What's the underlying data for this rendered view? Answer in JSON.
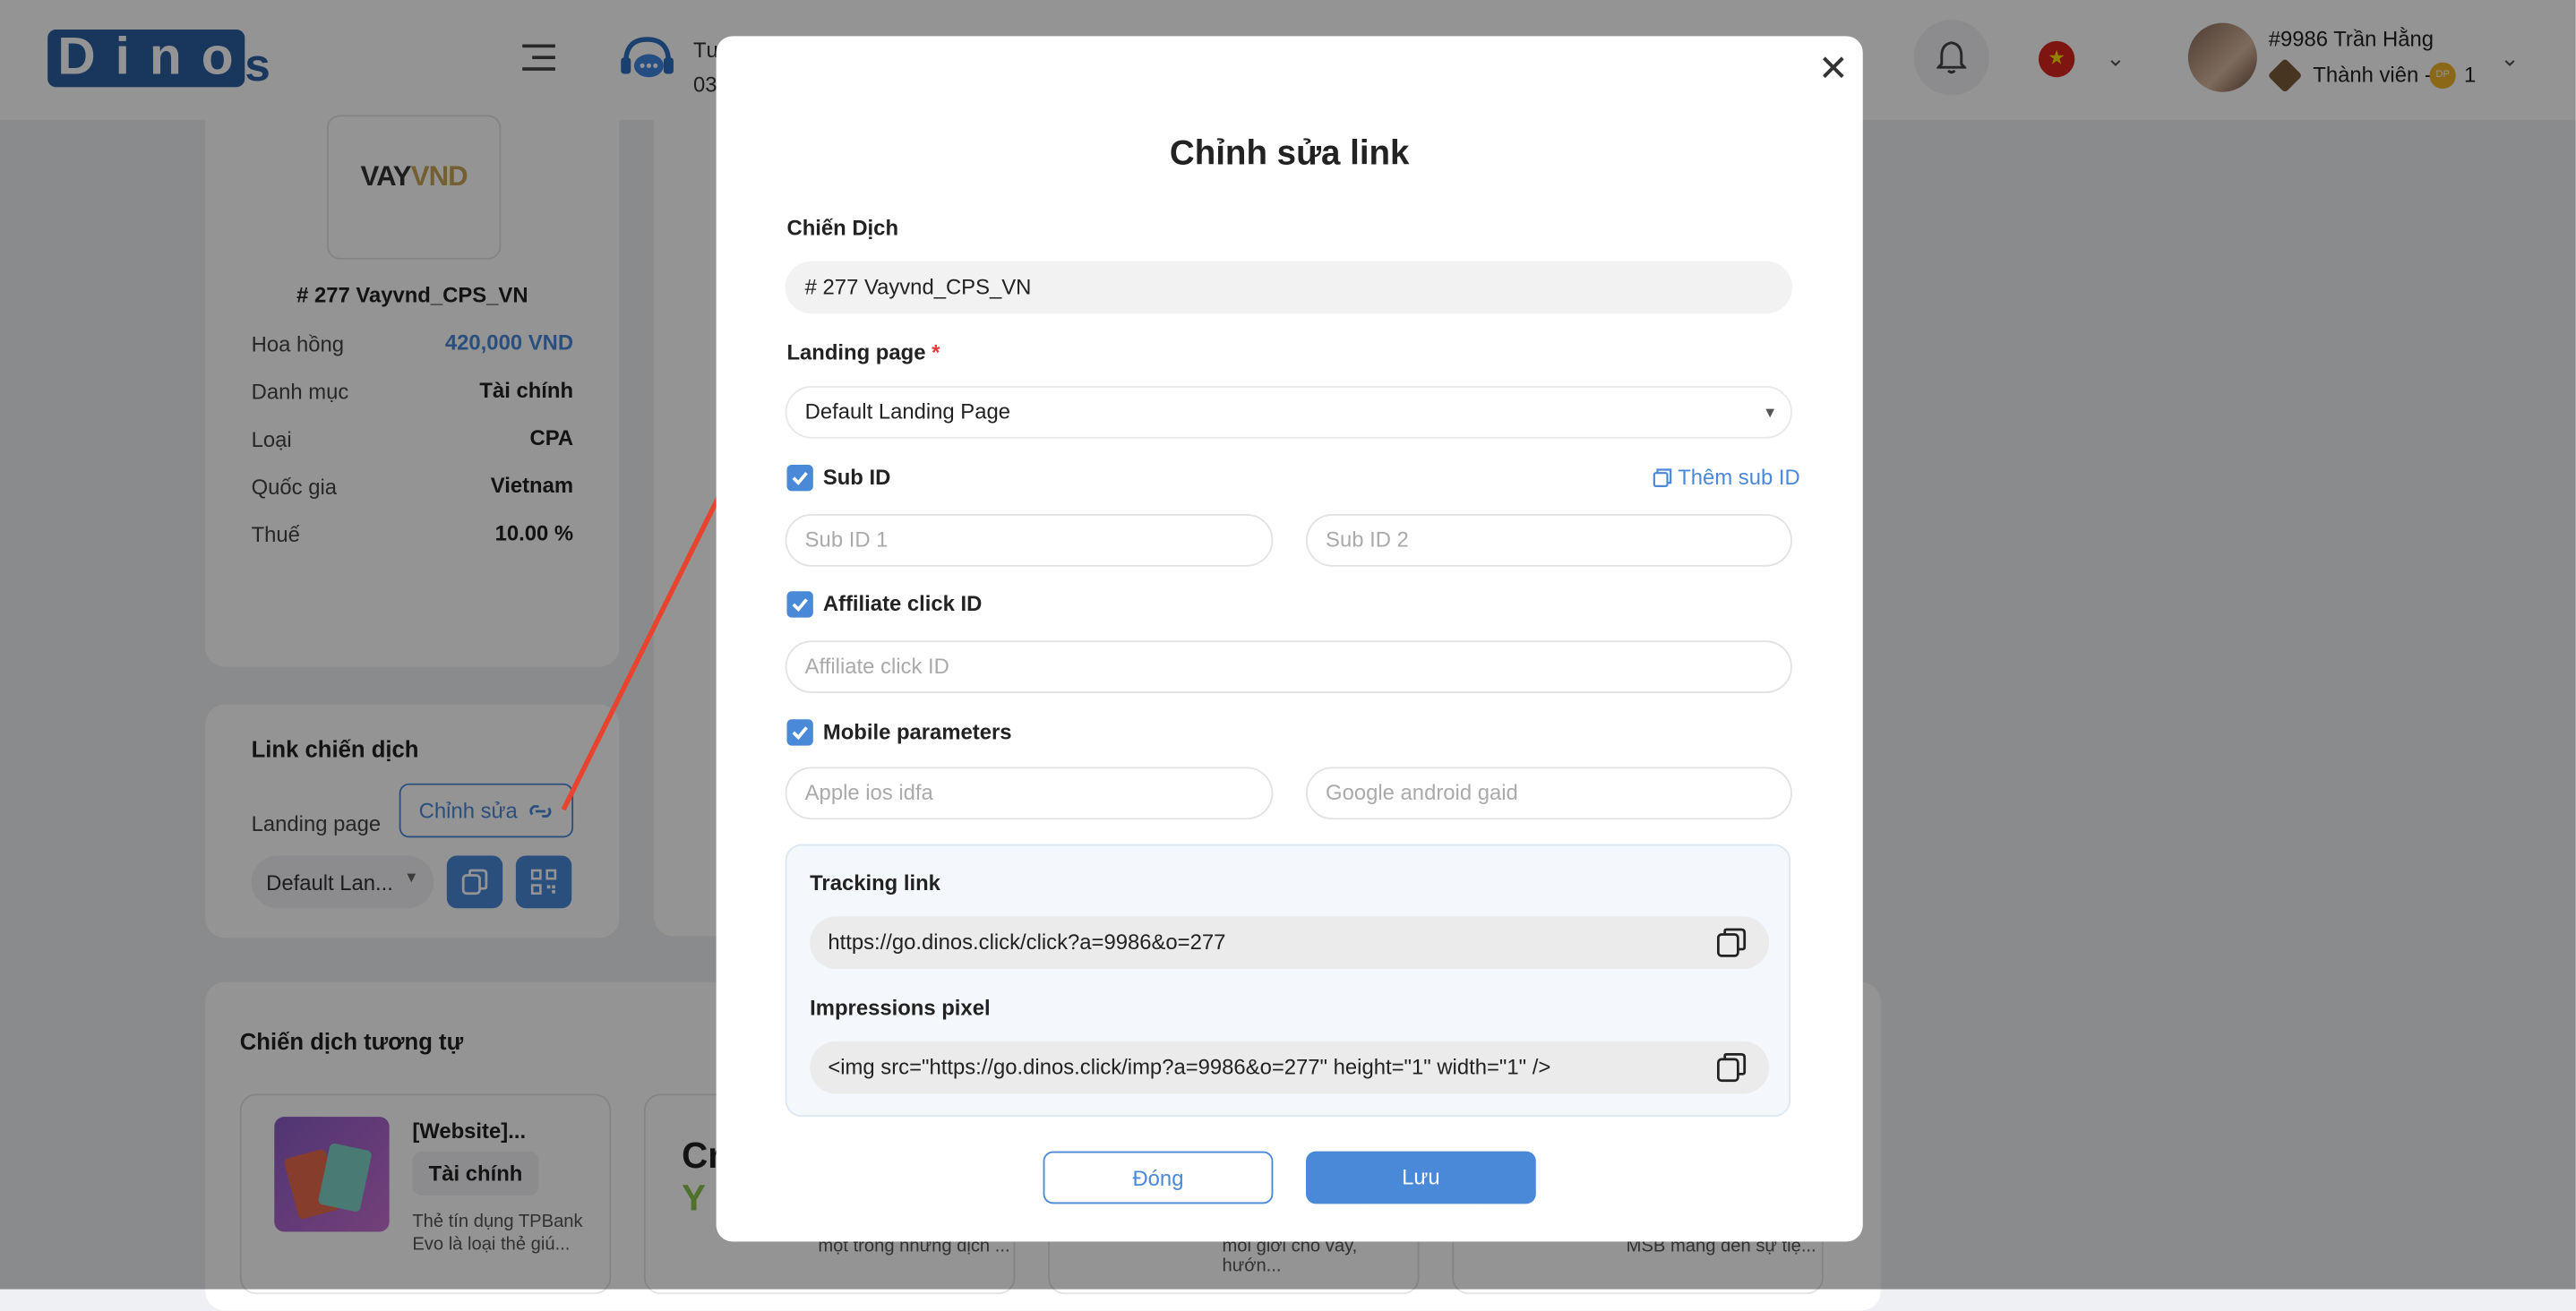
{
  "header": {
    "logo_text": "Dino",
    "logo_tail": "s",
    "support_line1": "Tư",
    "support_line2": "03",
    "user_name": "#9986 Trần Hằng",
    "rank_text": "Thành viên -",
    "coin_label": "DP",
    "coin_count": "1",
    "icons": [
      "menu-icon",
      "headset-icon",
      "bell-icon",
      "vietnam-flag-icon",
      "chevron-down-icon"
    ]
  },
  "campaign_card": {
    "logo_a": "VAY",
    "logo_b": "VND",
    "title": "# 277 Vayvnd_CPS_VN",
    "rows": [
      {
        "label": "Hoa hồng",
        "value": "420,000 VND"
      },
      {
        "label": "Danh mục",
        "value": "Tài chính"
      },
      {
        "label": "Loại",
        "value": "CPA"
      },
      {
        "label": "Quốc gia",
        "value": "Vietnam"
      },
      {
        "label": "Thuế",
        "value": "10.00 %"
      }
    ],
    "accent": "#4a88d8"
  },
  "link_card": {
    "title": "Link chiến dịch",
    "landing_label": "Landing page",
    "edit_button": "Chỉnh sửa",
    "select_value": "Default Lan..."
  },
  "similar": {
    "title": "Chiến dịch tương tự",
    "cards": [
      {
        "title": "[Website]...",
        "tag": "Tài chính",
        "desc": "Thẻ tín dụng TPBank Evo là loại thẻ giú..."
      },
      {
        "snippet": "một trong những dịch ..."
      },
      {
        "snippet": "môi giới cho vay, hướn..."
      },
      {
        "snippet": "MSB mang đến sự tiệ..."
      }
    ],
    "card2_logo_a": "Cr",
    "card2_logo_b": "Y"
  },
  "modal": {
    "title": "Chỉnh sửa link",
    "campaign_label": "Chiến Dịch",
    "campaign_value": "# 277 Vayvnd_CPS_VN",
    "landing_label": "Landing page",
    "required_mark": "*",
    "landing_value": "Default Landing Page",
    "subid_label": "Sub ID",
    "add_subid": "Thêm sub ID",
    "subid1_placeholder": "Sub ID 1",
    "subid2_placeholder": "Sub ID 2",
    "affiliate_label": "Affiliate click ID",
    "affiliate_placeholder": "Affiliate click ID",
    "mobile_label": "Mobile parameters",
    "idfa_placeholder": "Apple ios idfa",
    "gaid_placeholder": "Google android gaid",
    "tracking_label": "Tracking link",
    "tracking_url": "https://go.dinos.click/click?a=9986&o=277",
    "pixel_label": "Impressions pixel",
    "pixel_code": "<img src=\"https://go.dinos.click/imp?a=9986&o=277\" height=\"1\" width=\"1\" />",
    "close_button": "Đóng",
    "save_button": "Lưu",
    "checkboxes_checked": [
      true,
      true,
      true
    ]
  },
  "colors": {
    "primary": "#4a88d8",
    "annotation_arrow": "#e8432e",
    "overlay": "rgba(0,0,0,0.42)"
  }
}
